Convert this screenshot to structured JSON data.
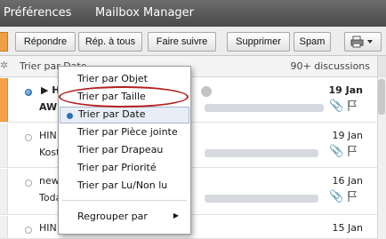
{
  "menubar": {
    "items": [
      "Préférences",
      "Mailbox Manager"
    ]
  },
  "toolbar": {
    "buttons": [
      "Répondre",
      "Rép. à tous",
      "Faire suivre",
      "Supprimer",
      "Spam"
    ],
    "print_icon": "printer-icon"
  },
  "listheader": {
    "sort_label": "Trier par Date",
    "count": "90+ discussions"
  },
  "messages": [
    {
      "sender": "H",
      "subject": "AW:",
      "date": "19 Jan",
      "unread": true,
      "selected": true,
      "blurred_subject": "Medikamentendaten - MED"
    },
    {
      "sender": "HIN",
      "subject": "Kost",
      "date": "19 Jan",
      "unread": false,
      "selected": false,
      "blurred_subject": "erientendaten - MEDupdate XML"
    },
    {
      "sender": "new",
      "subject": "Toda",
      "date": "16 Jan",
      "unread": false,
      "selected": false,
      "blurred_subject": "day's Press Verbindung der Sc"
    },
    {
      "sender": "HIN Administration",
      "subject": "",
      "date": "15 Jan",
      "unread": false,
      "selected": false,
      "blurred_subject": ""
    }
  ],
  "menu": {
    "items": [
      {
        "label": "Trier par Objet"
      },
      {
        "label": "Trier par Taille",
        "highlighted": true
      },
      {
        "label": "Trier par Date",
        "checked": true
      },
      {
        "label": "Trier par Pièce jointe"
      },
      {
        "label": "Trier par Drapeau"
      },
      {
        "label": "Trier par Priorité"
      },
      {
        "label": "Trier par Lu/Non lu"
      }
    ],
    "submenu": {
      "label": "Regrouper par"
    }
  },
  "colors": {
    "accent": "#f3a24a",
    "highlight_ring": "#b52020",
    "unread_dot": "#2d6fb7"
  }
}
